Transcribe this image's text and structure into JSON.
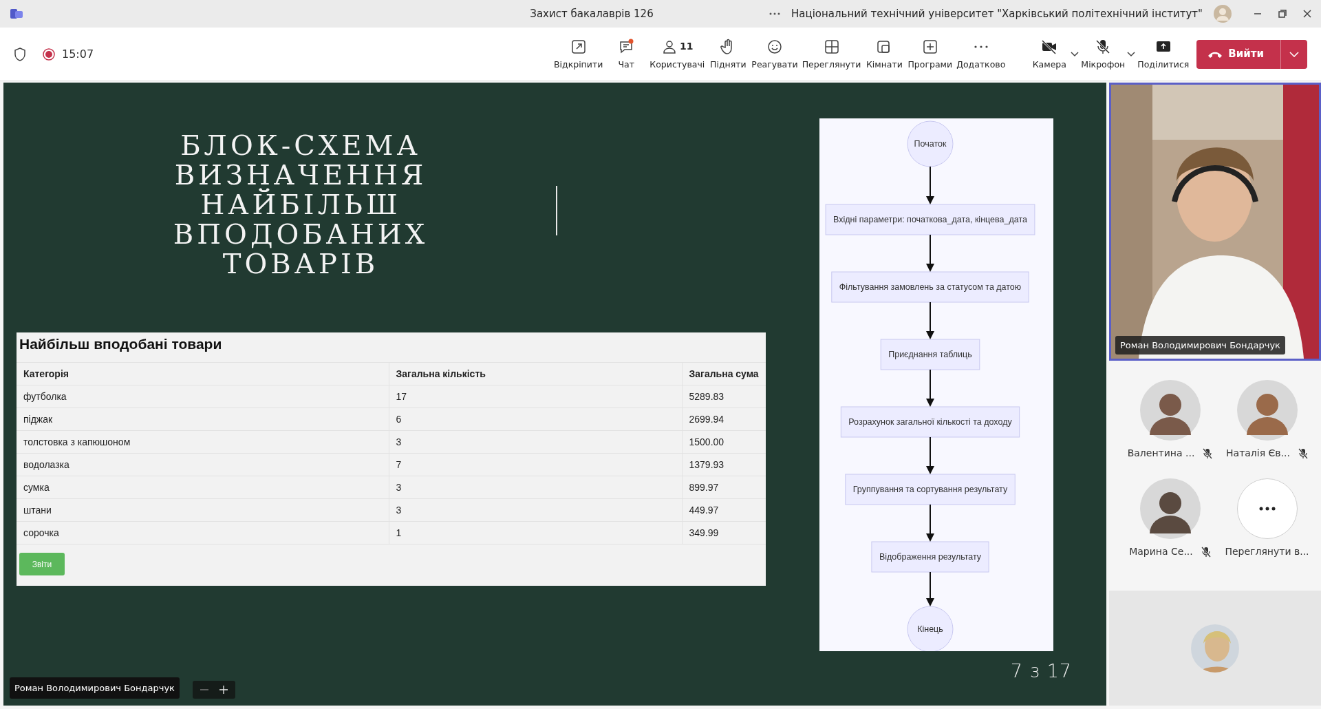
{
  "window": {
    "title": "Захист бакалаврів 126",
    "organization": "Національний технічний університет \"Харківський політехнічний інститут\""
  },
  "meeting": {
    "time": "15:07",
    "recording": true
  },
  "toolbar": [
    {
      "kind": "popout",
      "label": "Відкріпити"
    },
    {
      "kind": "chat",
      "label": "Чат",
      "unread": true
    },
    {
      "kind": "people",
      "label": "Користувачі",
      "count": "11"
    },
    {
      "kind": "hand",
      "label": "Підняти"
    },
    {
      "kind": "react",
      "label": "Реагувати"
    },
    {
      "kind": "view",
      "label": "Переглянути"
    },
    {
      "kind": "rooms",
      "label": "Кімнати"
    },
    {
      "kind": "apps",
      "label": "Програми"
    },
    {
      "kind": "more",
      "label": "Додатково"
    },
    {
      "kind": "camera",
      "label": "Камера",
      "off": true,
      "dropdown": true
    },
    {
      "kind": "mic",
      "label": "Мікрофон",
      "off": true,
      "dropdown": true
    },
    {
      "kind": "share",
      "label": "Поділитися"
    }
  ],
  "leave_button": {
    "label": "Вийти"
  },
  "slide": {
    "title": "БЛОК-СХЕМА ВИЗНАЧЕННЯ НАЙБІЛЬШ ВПОДОБАНИХ ТОВАРІВ",
    "table": {
      "title": "Найбільш вподобані товари",
      "columns": [
        "Категорія",
        "Загальна кількість",
        "Загальна сума"
      ],
      "rows": [
        [
          "футболка",
          "17",
          "5289.83"
        ],
        [
          "піджак",
          "6",
          "2699.94"
        ],
        [
          "толстовка з капюшоном",
          "3",
          "1500.00"
        ],
        [
          "водолазка",
          "7",
          "1379.93"
        ],
        [
          "сумка",
          "3",
          "899.97"
        ],
        [
          "штани",
          "3",
          "449.97"
        ],
        [
          "сорочка",
          "1",
          "349.99"
        ]
      ],
      "button": "Звіти"
    },
    "flowchart": [
      {
        "kind": "terminal",
        "label": "Початок"
      },
      {
        "kind": "process",
        "label": "Вхідні параметри: початкова_дата, кінцева_дата"
      },
      {
        "kind": "process",
        "label": "Фільтування замовлень за статусом та датою"
      },
      {
        "kind": "process",
        "label": "Приєднання таблиць"
      },
      {
        "kind": "process",
        "label": "Розрахунок загальної кількості та доходу"
      },
      {
        "kind": "process",
        "label": "Группування та сортування результату"
      },
      {
        "kind": "process",
        "label": "Відображення результату"
      },
      {
        "kind": "terminal",
        "label": "Кінець"
      }
    ],
    "page_indicator": "7 з 17"
  },
  "presenter": {
    "name": "Роман Володимирович Бондарчук"
  },
  "video": {
    "name": "Роман Володимирович Бондарчук",
    "speaking": true
  },
  "participants": [
    {
      "name": "Валентина ...",
      "muted": true,
      "color": "#7a5a4a"
    },
    {
      "name": "Наталія Єв...",
      "muted": true,
      "color": "#9a6a4a"
    },
    {
      "name": "Марина Се...",
      "muted": true,
      "color": "#5a4a40"
    },
    {
      "kind": "more",
      "name": "Переглянути в..."
    }
  ]
}
